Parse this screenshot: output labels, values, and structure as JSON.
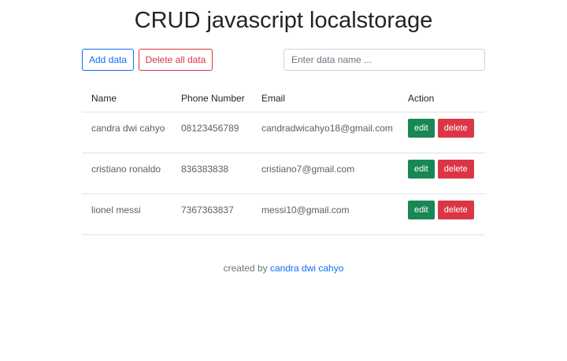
{
  "title": "CRUD javascript localstorage",
  "toolbar": {
    "add_label": "Add data",
    "delete_all_label": "Delete all data",
    "search_placeholder": "Enter data name ..."
  },
  "table": {
    "headers": [
      "Name",
      "Phone Number",
      "Email",
      "Action"
    ],
    "rows": [
      {
        "name": "candra dwi cahyo",
        "phone": "08123456789",
        "email": "candradwicahyo18@gmail.com"
      },
      {
        "name": "cristiano ronaldo",
        "phone": "836383838",
        "email": "cristiano7@gmail.com"
      },
      {
        "name": "lionel messi",
        "phone": "7367363837",
        "email": "messi10@gmail.com"
      }
    ],
    "edit_label": "edit",
    "delete_label": "delete"
  },
  "footer": {
    "prefix": "created by",
    "author": "candra dwi cahyo"
  },
  "colors": {
    "primary": "#0d6efd",
    "danger": "#dc3545",
    "success": "#198754"
  }
}
